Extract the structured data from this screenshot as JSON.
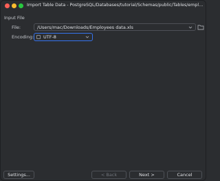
{
  "window": {
    "title": "Import Table Data - PostgreSQL/Databases/tutorial/Schemas/public/Tables/employ..."
  },
  "form": {
    "section_label": "Input File",
    "file_label": "File:",
    "file_value": "/Users/mac/Downloads/Employees data.xls",
    "encoding_label": "Encoding:",
    "encoding_value": "UTF-8"
  },
  "buttons": {
    "settings": "Settings...",
    "back": "< Back",
    "next": "Next >",
    "cancel": "Cancel"
  },
  "icons": {
    "file_dropdown": "chevron-down-icon",
    "browse": "folder-icon",
    "encoding_dropdown": "chevron-down-icon"
  },
  "colors": {
    "accent": "#3574f0",
    "background": "#2b2d30",
    "close": "#ff5f57",
    "minimize": "#febc2e",
    "maximize": "#28c840"
  }
}
